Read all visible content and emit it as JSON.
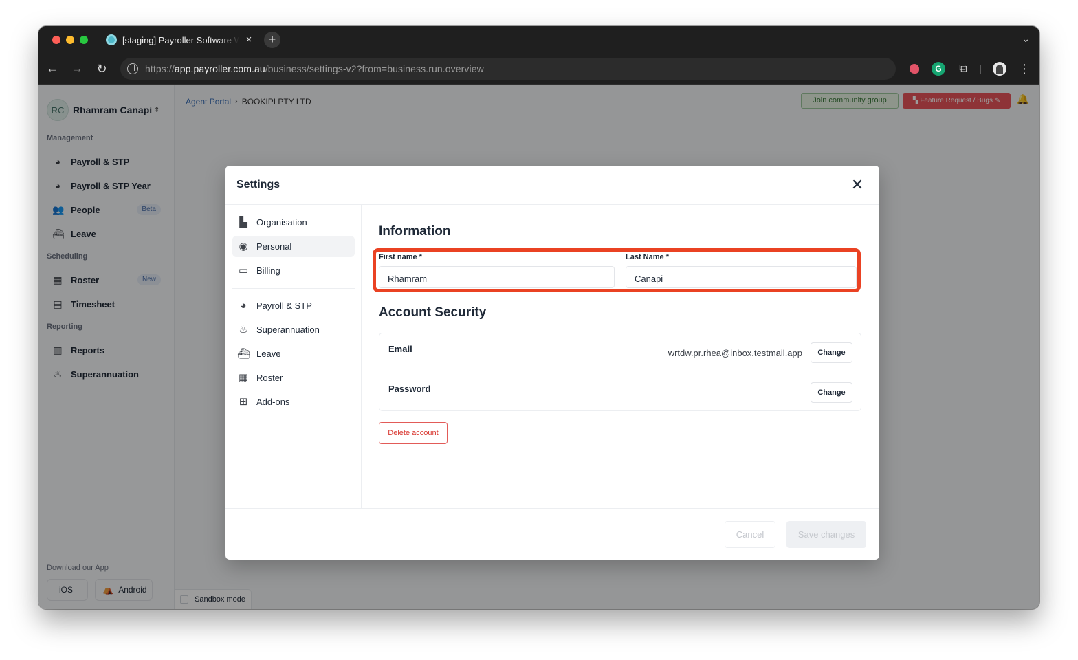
{
  "browser": {
    "tab_title": "[staging] Payroller Software Web",
    "tab_close": "×",
    "new_tab": "+",
    "url_prefix": "https://",
    "url_host": "app.payroller.com.au",
    "url_path": "/business/settings-v2?from=business.run.overview",
    "extension_letter": "G"
  },
  "sidebar": {
    "user_initials": "RC",
    "user_name": "Rhamram Canapi",
    "sections": {
      "management": "Management",
      "scheduling": "Scheduling",
      "reporting": "Reporting"
    },
    "items": {
      "payroll": {
        "label": "Payroll & STP",
        "icon": "payroll-icon"
      },
      "payroll_year": {
        "label": "Payroll & STP Year",
        "icon": "payroll-icon"
      },
      "people": {
        "label": "People",
        "icon": "people-icon",
        "badge": "Beta"
      },
      "leave": {
        "label": "Leave",
        "icon": "leave-icon"
      },
      "roster": {
        "label": "Roster",
        "icon": "calendar-icon",
        "badge": "New"
      },
      "timesheet": {
        "label": "Timesheet",
        "icon": "timesheet-icon"
      },
      "reports": {
        "label": "Reports",
        "icon": "reports-icon"
      },
      "superannuation": {
        "label": "Superannuation",
        "icon": "piggy-bank-icon"
      }
    },
    "download_title": "Download our App",
    "ios_label": "iOS",
    "android_label": "Android"
  },
  "topbar": {
    "breadcrumb_link": "Agent Portal",
    "breadcrumb_current": "BOOKIPI PTY LTD",
    "community_label": "Join community group",
    "feature_label": "Feature Request / Bugs"
  },
  "sandbox_label": "Sandbox mode",
  "modal": {
    "title": "Settings",
    "nav": {
      "organisation": "Organisation",
      "personal": "Personal",
      "billing": "Billing",
      "payroll": "Payroll & STP",
      "superannuation": "Superannuation",
      "leave": "Leave",
      "roster": "Roster",
      "addons": "Add-ons"
    },
    "information_heading": "Information",
    "first_name_label": "First name *",
    "first_name_value": "Rhamram",
    "last_name_label": "Last Name *",
    "last_name_value": "Canapi",
    "security_heading": "Account Security",
    "email_label": "Email",
    "email_value": "wrtdw.pr.rhea@inbox.testmail.app",
    "password_label": "Password",
    "change_label": "Change",
    "delete_label": "Delete account",
    "cancel_label": "Cancel",
    "save_label": "Save changes"
  },
  "colors": {
    "highlight": "#ea4223",
    "link": "#3b6fb6",
    "feature_button": "#e9545a",
    "community_button": "#e8f4e4"
  }
}
